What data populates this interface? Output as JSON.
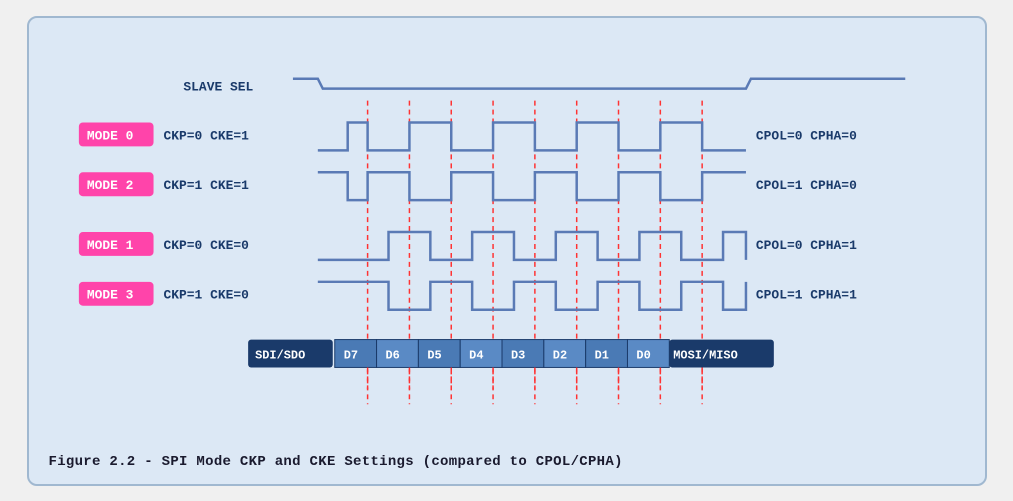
{
  "caption": "Figure 2.2 - SPI Mode CKP and CKE Settings (compared to CPOL/CPHA)",
  "modes": [
    {
      "id": "MODE 0",
      "params": "CKP=0  CKE=1",
      "right": "CPOL=0  CPHA=0"
    },
    {
      "id": "MODE 2",
      "params": "CKP=1  CKE=1",
      "right": "CPOL=1  CPHA=0"
    },
    {
      "id": "MODE 1",
      "params": "CKP=0  CKE=0",
      "right": "CPOL=0  CPHA=1"
    },
    {
      "id": "MODE 3",
      "params": "CKP=1  CKE=0",
      "right": "CPOL=1  CPHA=1"
    }
  ],
  "slave_sel_label": "SLAVE SEL",
  "data_labels": [
    "D7",
    "D6",
    "D5",
    "D4",
    "D3",
    "D2",
    "D1",
    "D0"
  ],
  "data_left": "SDI/SDO",
  "data_right": "MOSI/MISO"
}
